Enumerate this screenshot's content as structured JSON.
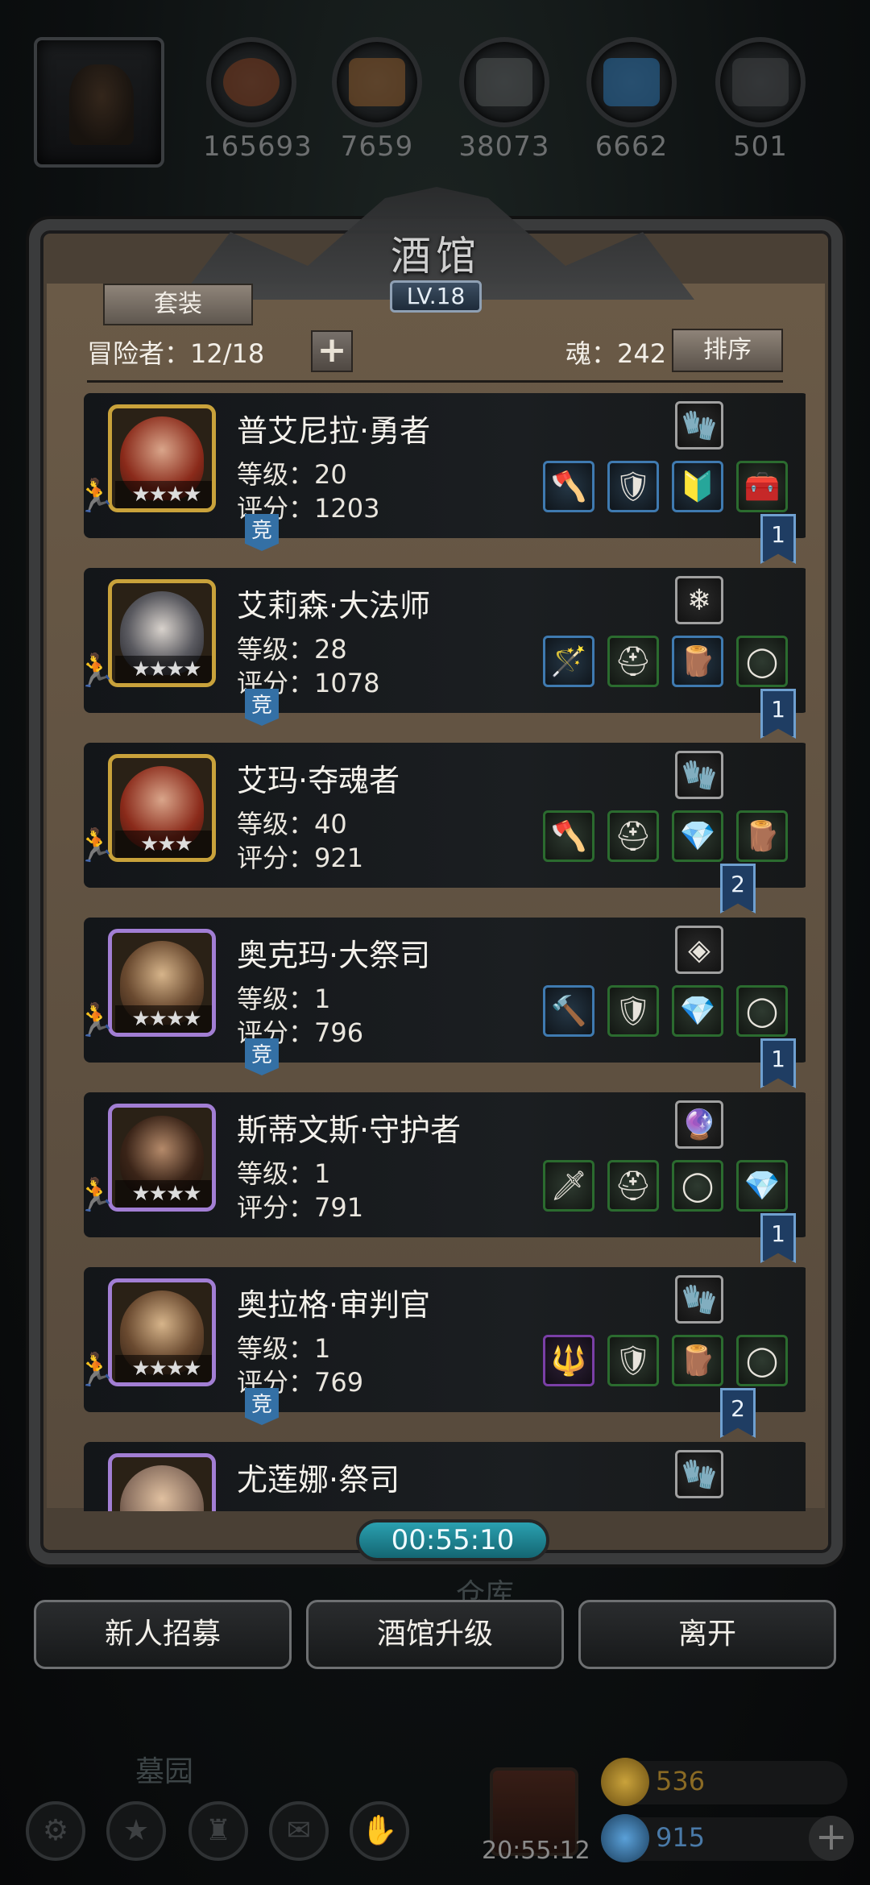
{
  "resources": [
    {
      "icon": "meat-icon",
      "value": "165693",
      "color": "#7a3b1e"
    },
    {
      "icon": "wood-icon",
      "value": "7659",
      "color": "#8a5a2c"
    },
    {
      "icon": "iron-icon",
      "value": "38073",
      "color": "#505354"
    },
    {
      "icon": "crystal-icon",
      "value": "6662",
      "color": "#2a6fa8"
    },
    {
      "icon": "ingot-icon",
      "value": "501",
      "color": "#404244"
    }
  ],
  "tavern": {
    "title": "酒馆",
    "level": "LV.18",
    "set_tab": "套装",
    "adventurers": "冒险者：12/18",
    "soul": "魂：242",
    "sort": "排序",
    "timer": "00:55:10"
  },
  "heroes": [
    {
      "name": "普艾尼拉·勇者",
      "level": "等级：20",
      "score": "评分：1203",
      "stars": "★★★★",
      "frame": "gold",
      "comp": "竞",
      "rank": "1"
    },
    {
      "name": "艾莉森·大法师",
      "level": "等级：28",
      "score": "评分：1078",
      "stars": "★★★★",
      "frame": "gold",
      "comp": "竞",
      "rank": "1"
    },
    {
      "name": "艾玛·夺魂者",
      "level": "等级：40",
      "score": "评分：921",
      "stars": "★★★",
      "frame": "gold",
      "comp": "",
      "rank": "2"
    },
    {
      "name": "奥克玛·大祭司",
      "level": "等级：1",
      "score": "评分：796",
      "stars": "★★★★",
      "frame": "purple",
      "comp": "竞",
      "rank": "1"
    },
    {
      "name": "斯蒂文斯·守护者",
      "level": "等级：1",
      "score": "评分：791",
      "stars": "★★★★",
      "frame": "purple",
      "comp": "",
      "rank": "1"
    },
    {
      "name": "奥拉格·审判官",
      "level": "等级：1",
      "score": "评分：769",
      "stars": "★★★★",
      "frame": "purple",
      "comp": "竞",
      "rank": "2"
    },
    {
      "name": "尤莲娜·祭司",
      "level": "",
      "score": "",
      "stars": "",
      "frame": "purple",
      "comp": "",
      "rank": ""
    }
  ],
  "buttons": {
    "recruit": "新人招募",
    "upgrade": "酒馆升级",
    "leave": "离开"
  },
  "background": {
    "warehouse": "仓库",
    "graveyard": "墓园"
  },
  "bottom": {
    "gift_timer": "20:55:12",
    "gold": "536",
    "gems": "915"
  }
}
